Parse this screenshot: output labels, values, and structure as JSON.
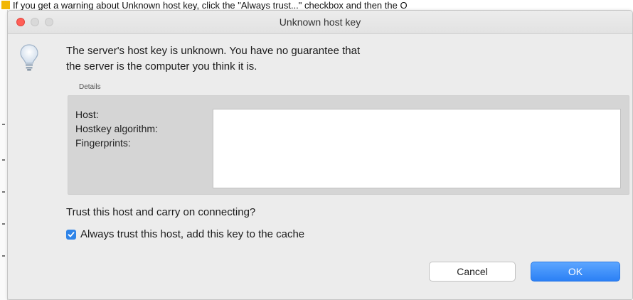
{
  "caption": {
    "text": "If you get a warning about Unknown host key, click the \"Always trust...\" checkbox and then the O"
  },
  "dialog": {
    "title": "Unknown host key",
    "message_line1": "The server's host key is unknown. You have no guarantee that",
    "message_line2": "the server is the computer you think it is.",
    "details_label": "Details",
    "details": {
      "host_label": "Host:",
      "algorithm_label": "Hostkey algorithm:",
      "fingerprints_label": "Fingerprints:",
      "values": ""
    },
    "question": "Trust this host and carry on connecting?",
    "checkbox": {
      "label": "Always trust this host, add this key to the cache",
      "checked": true
    },
    "cancel_label": "Cancel",
    "ok_label": "OK"
  },
  "colors": {
    "accent": "#2f84e8",
    "close": "#ff5f57",
    "caption_icon": "#f2b705"
  }
}
